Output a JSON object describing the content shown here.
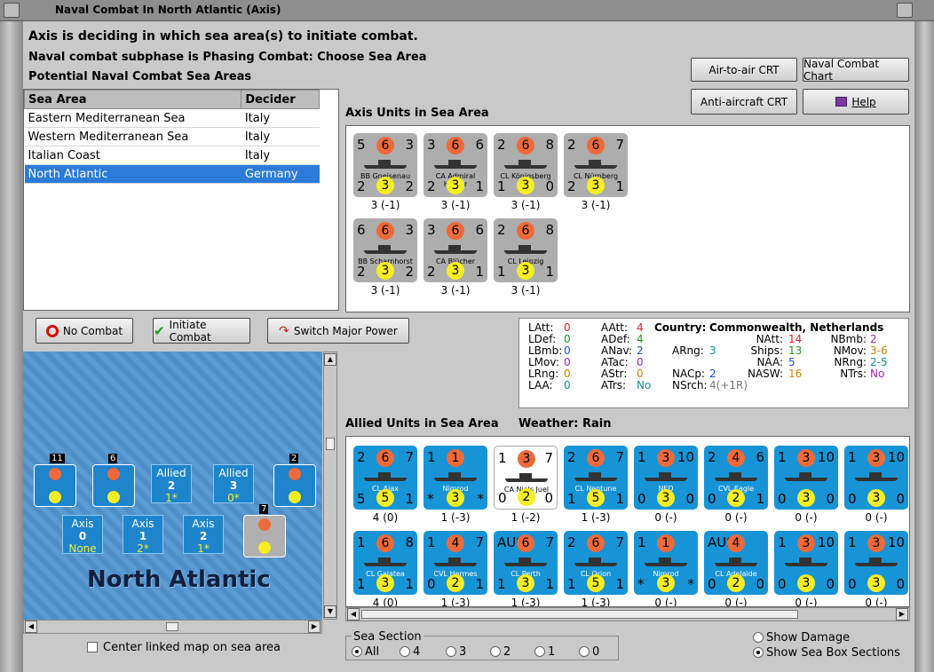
{
  "window": {
    "title": "Naval Combat In North Atlantic (Axis)"
  },
  "header": {
    "line1": "Axis is deciding in which sea area(s) to initiate combat.",
    "line2": "Naval combat subphase is Phasing Combat: Choose Sea Area",
    "line3": "Potential Naval Combat Sea Areas"
  },
  "top_buttons": {
    "air_to_air": "Air-to-air CRT",
    "naval_chart": "Naval Combat Chart",
    "anti_aircraft": "Anti-aircraft CRT",
    "help": "Help"
  },
  "sea_table": {
    "col1": "Sea Area",
    "col2": "Decider",
    "rows": [
      {
        "area": "Eastern Mediterranean Sea",
        "decider": "Italy"
      },
      {
        "area": "Western Mediterranean Sea",
        "decider": "Italy"
      },
      {
        "area": "Italian Coast",
        "decider": "Italy"
      },
      {
        "area": "North Atlantic",
        "decider": "Germany"
      }
    ]
  },
  "axis_units": {
    "label": "Axis Units in Sea Area",
    "units": [
      {
        "tl": "5",
        "o": "6",
        "tr": "3",
        "name": "BB Gneisenau",
        "bl": "2",
        "y": "3",
        "br": "2",
        "val": "3 (-1)"
      },
      {
        "tl": "3",
        "o": "6",
        "tr": "6",
        "name": "CA Admiral Hipper",
        "bl": "2",
        "y": "3",
        "br": "1",
        "val": "3 (-1)"
      },
      {
        "tl": "2",
        "o": "6",
        "tr": "8",
        "name": "CL Königsberg",
        "bl": "1",
        "y": "3",
        "br": "0",
        "val": "3 (-1)"
      },
      {
        "tl": "2",
        "o": "6",
        "tr": "7",
        "name": "CL Nürnberg",
        "bl": "2",
        "y": "3",
        "br": "1",
        "val": "3 (-1)"
      },
      {
        "tl": "6",
        "o": "6",
        "tr": "3",
        "name": "BB Scharnhorst",
        "bl": "2",
        "y": "3",
        "br": "2",
        "val": "3 (-1)"
      },
      {
        "tl": "3",
        "o": "6",
        "tr": "6",
        "name": "CA Blücher",
        "bl": "2",
        "y": "3",
        "br": "1",
        "val": "3 (-1)"
      },
      {
        "tl": "2",
        "o": "6",
        "tr": "8",
        "name": "CL Leipzig",
        "bl": "1",
        "y": "3",
        "br": "1",
        "val": "3 (-1)"
      }
    ]
  },
  "action_buttons": {
    "no_combat": "No Combat",
    "initiate": "Initiate Combat",
    "switch": "Switch Major Power"
  },
  "stats": {
    "country_label": "Country:",
    "country": "Commonwealth, Netherlands",
    "c1": [
      [
        "LAtt:",
        "0"
      ],
      [
        "LDef:",
        "0"
      ],
      [
        "LBmb:",
        "0"
      ],
      [
        "LMov:",
        "0"
      ],
      [
        "LRng:",
        "0"
      ],
      [
        "LAA:",
        "0"
      ]
    ],
    "c2": [
      [
        "AAtt:",
        "4"
      ],
      [
        "ADef:",
        "4"
      ],
      [
        "ANav:",
        "2"
      ],
      [
        "ATac:",
        "0"
      ],
      [
        "AStr:",
        "0"
      ],
      [
        "ATrs:",
        "No"
      ]
    ],
    "c3": [
      [
        "ARng:",
        "3"
      ],
      [
        "NACp:",
        "2"
      ],
      [
        "NSrch:",
        "4(+1R)"
      ]
    ],
    "c4": [
      [
        "NAtt:",
        "14"
      ],
      [
        "Ships:",
        "13"
      ],
      [
        "NAA:",
        "5"
      ],
      [
        "NASW:",
        "16"
      ]
    ],
    "c5": [
      [
        "NBmb:",
        "2"
      ],
      [
        "NMov:",
        "3-6"
      ],
      [
        "NRng:",
        "2-5"
      ],
      [
        "NTrs:",
        "No"
      ]
    ]
  },
  "allied": {
    "label": "Allied Units in Sea Area",
    "weather_label": "Weather:",
    "weather": "Rain",
    "units": [
      {
        "tl": "2",
        "o": "6",
        "tr": "7",
        "name": "CL Ajax",
        "bl": "5",
        "y": "5",
        "br": "1",
        "val": "4 (0)"
      },
      {
        "tl": "1",
        "o": "1",
        "tr": "",
        "name": "Nimrod",
        "bl": "*",
        "y": "3",
        "br": "*",
        "val": "1 (-3)"
      },
      {
        "tl": "1",
        "o": "3",
        "tr": "7",
        "name": "CA Niels Juel",
        "bl": "0",
        "y": "2",
        "br": "0",
        "val": "1 (-2)"
      },
      {
        "tl": "2",
        "o": "6",
        "tr": "7",
        "name": "CL Neptune",
        "bl": "1",
        "y": "5",
        "br": "1",
        "val": "1 (-3)"
      },
      {
        "tl": "1",
        "o": "3",
        "tr": "10",
        "name": "NED",
        "bl": "0",
        "y": "3",
        "br": "0",
        "val": "0 (-)"
      },
      {
        "tl": "2",
        "o": "4",
        "tr": "6",
        "name": "CVL Eagle",
        "bl": "0",
        "y": "2",
        "br": "1",
        "val": "0 (-)"
      },
      {
        "tl": "1",
        "o": "3",
        "tr": "10",
        "name": "",
        "bl": "0",
        "y": "3",
        "br": "0",
        "val": "0 (-)"
      },
      {
        "tl": "1",
        "o": "3",
        "tr": "10",
        "name": "",
        "bl": "0",
        "y": "3",
        "br": "0",
        "val": "0 (-)"
      },
      {
        "tl": "1",
        "o": "6",
        "tr": "8",
        "name": "CL Galatea",
        "bl": "1",
        "y": "3",
        "br": "1",
        "val": "4 (0)"
      },
      {
        "tl": "1",
        "o": "4",
        "tr": "7",
        "name": "CVL Hermes",
        "bl": "0",
        "y": "2",
        "br": "1",
        "val": "1 (-3)"
      },
      {
        "tl": "AUS",
        "o": "6",
        "tr": "7",
        "name": "CL Perth",
        "bl": "1",
        "y": "3",
        "br": "1",
        "val": "1 (-3)"
      },
      {
        "tl": "2",
        "o": "6",
        "tr": "7",
        "name": "CL Orion",
        "bl": "1",
        "y": "5",
        "br": "1",
        "val": "1 (-3)"
      },
      {
        "tl": "1",
        "o": "1",
        "tr": "",
        "name": "Nimrod",
        "bl": "*",
        "y": "3",
        "br": "*",
        "val": "0 (-)"
      },
      {
        "tl": "AUS",
        "o": "4",
        "tr": "",
        "name": "CL Adelaide",
        "bl": "0",
        "y": "2",
        "br": "0",
        "val": "0 (-)"
      },
      {
        "tl": "1",
        "o": "3",
        "tr": "10",
        "name": "",
        "bl": "0",
        "y": "3",
        "br": "0",
        "val": "0 (-)"
      },
      {
        "tl": "1",
        "o": "3",
        "tr": "10",
        "name": "",
        "bl": "0",
        "y": "3",
        "br": "0",
        "val": "0 (-)"
      }
    ]
  },
  "map": {
    "title": "North Atlantic",
    "boxes": [
      {
        "l1": "Allied",
        "l2": "2",
        "l3": "1*"
      },
      {
        "l1": "Allied",
        "l2": "3",
        "l3": "0*"
      },
      {
        "l1": "Axis",
        "l2": "0",
        "l3": "None"
      },
      {
        "l1": "Axis",
        "l2": "1",
        "l3": "2*"
      },
      {
        "l1": "Axis",
        "l2": "2",
        "l3": "1*"
      }
    ],
    "badges": [
      "11",
      "6",
      "2",
      "7"
    ],
    "center_label": "Center linked map on sea area"
  },
  "sea_section": {
    "label": "Sea Section",
    "options": [
      "All",
      "4",
      "3",
      "2",
      "1",
      "0"
    ]
  },
  "options": {
    "show_damage": "Show Damage",
    "show_sea_box": "Show Sea Box Sections"
  }
}
